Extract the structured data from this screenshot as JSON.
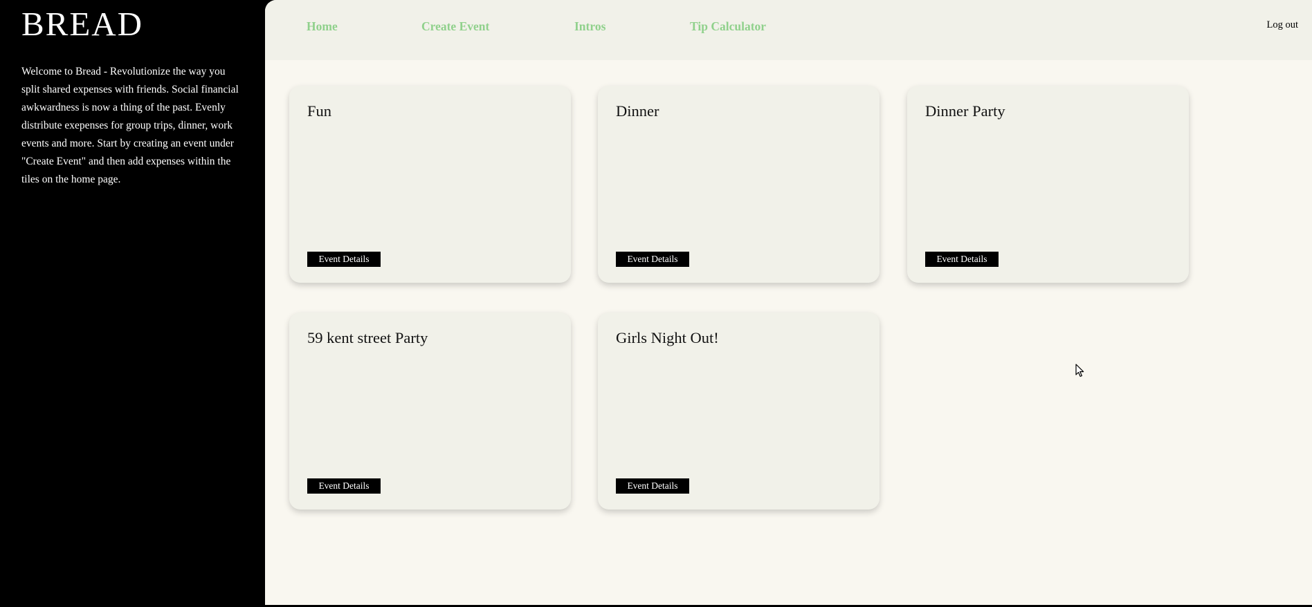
{
  "sidebar": {
    "brand": "BREAD",
    "intro": "Welcome to Bread - Revolutionize the way you split shared expenses with friends. Social financial awkwardness is now a thing of the past. Evenly distribute exepenses for group trips, dinner, work events and more. Start by creating an event under \"Create Event\" and then add expenses within the tiles on the home page."
  },
  "nav": {
    "items": [
      {
        "label": "Home"
      },
      {
        "label": "Create Event"
      },
      {
        "label": "Intros"
      },
      {
        "label": "Tip Calculator"
      }
    ],
    "logout_label": "Log out"
  },
  "events": [
    {
      "title": "Fun",
      "button_label": "Event Details"
    },
    {
      "title": "Dinner",
      "button_label": "Event Details"
    },
    {
      "title": "Dinner Party",
      "button_label": "Event Details"
    },
    {
      "title": "59 kent street Party",
      "button_label": "Event Details"
    },
    {
      "title": "Girls Night Out!",
      "button_label": "Event Details"
    }
  ],
  "colors": {
    "sidebar_bg": "#000000",
    "main_bg": "#f9f7f0",
    "topbar_bg": "#f1f1e9",
    "card_bg": "#f1f1e9",
    "nav_link": "#90d18c",
    "button_bg": "#000000"
  },
  "icons": {
    "cursor": "mouse-pointer-icon"
  }
}
